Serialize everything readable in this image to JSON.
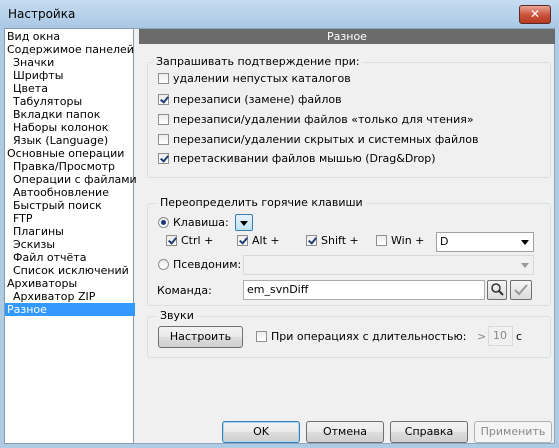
{
  "window": {
    "title": "Настройка",
    "close_glyph": "✕"
  },
  "tree": {
    "items": [
      "Вид окна",
      "Содержимое панелей",
      "Значки",
      "Шрифты",
      "Цвета",
      "Табуляторы",
      "Вкладки папок",
      "Наборы колонок",
      "Язык (Language)",
      "Основные операции",
      "Правка/Просмотр",
      "Операции с файлами",
      "Автообновление",
      "Быстрый поиск",
      "FTP",
      "Плагины",
      "Эскизы",
      "Файл отчёта",
      "Список исключений",
      "Архиваторы",
      "Архиватор ZIP",
      "Разное"
    ],
    "selected": "Разное"
  },
  "page": {
    "header": "Разное"
  },
  "confirm": {
    "legend": "Запрашивать подтверждение при:",
    "items": [
      {
        "label": "удалении непустых каталогов",
        "checked": false
      },
      {
        "label": "перезаписи (замене) файлов",
        "checked": true
      },
      {
        "label": "перезаписи/удалении файлов «только для чтения»",
        "checked": false
      },
      {
        "label": "перезаписи/удалении скрытых и системных файлов",
        "checked": false
      },
      {
        "label": "перетаскивании файлов мышью (Drag&Drop)",
        "checked": true
      }
    ]
  },
  "hotkeys": {
    "legend": "Переопределить горячие клавиши",
    "key_radio": "Клавиша:",
    "key_radio_checked": true,
    "ctrl": "Ctrl +",
    "ctrl_checked": true,
    "alt": "Alt +",
    "alt_checked": true,
    "shift": "Shift +",
    "shift_checked": true,
    "win": "Win +",
    "win_checked": false,
    "key_value": "D",
    "alias_radio": "Псевдоним:",
    "alias_value": "",
    "command_label": "Команда:",
    "command_value": "em_svnDiff"
  },
  "sounds": {
    "legend": "Звуки",
    "configure": "Настроить",
    "duration_label": "При операциях с длительностью:",
    "duration_checked": false,
    "prefix": ">",
    "seconds": "10",
    "unit": "с"
  },
  "footer": {
    "ok": "OK",
    "cancel": "Отмена",
    "help": "Справка",
    "apply": "Применить"
  }
}
